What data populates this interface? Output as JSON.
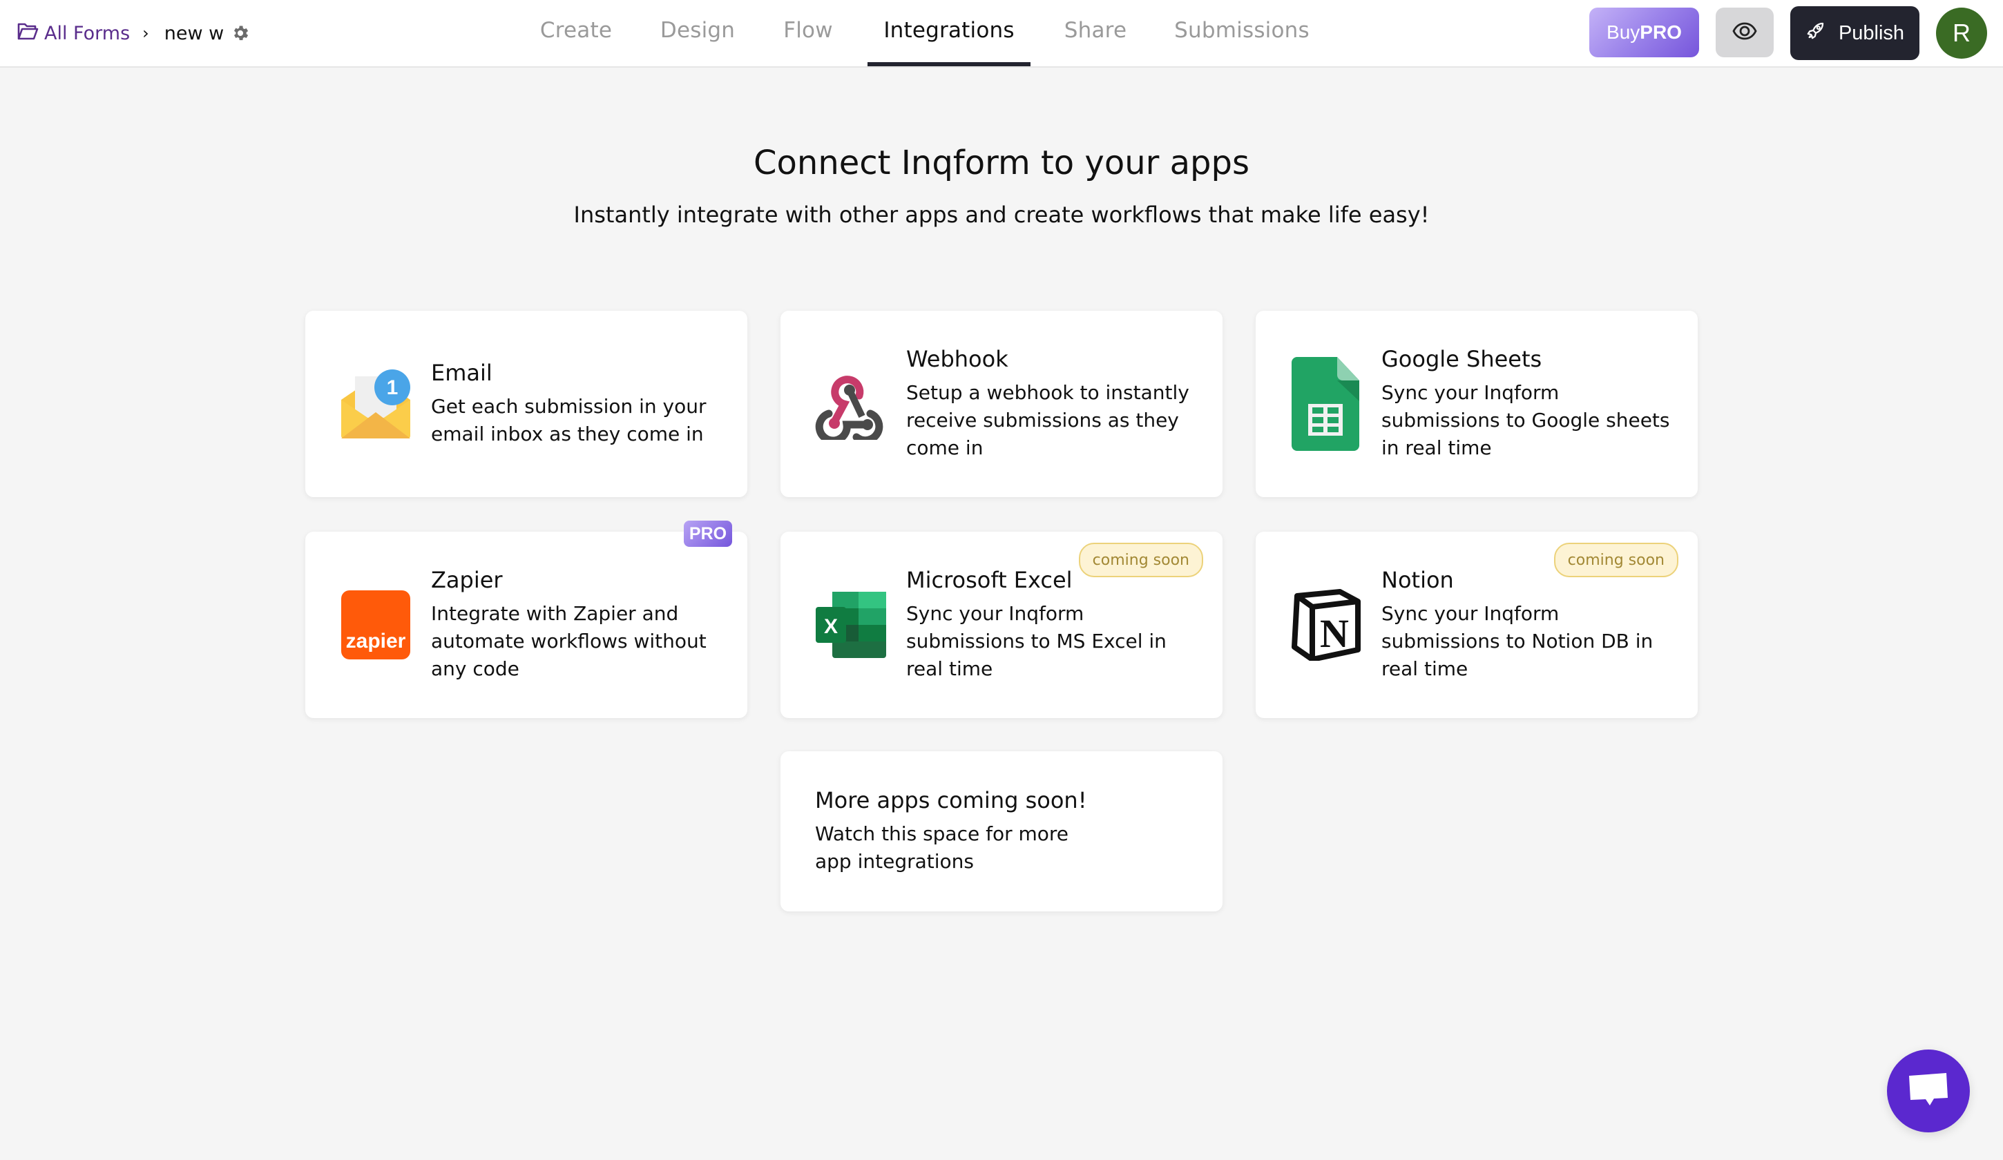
{
  "header": {
    "breadcrumb": {
      "root_label": "All Forms",
      "root_icon": "folder-icon",
      "separator_icon": "chevron-right-icon",
      "current": "new w",
      "settings_icon": "gear-icon"
    },
    "tabs": [
      {
        "label": "Create",
        "active": false
      },
      {
        "label": "Design",
        "active": false
      },
      {
        "label": "Flow",
        "active": false
      },
      {
        "label": "Integrations",
        "active": true
      },
      {
        "label": "Share",
        "active": false
      },
      {
        "label": "Submissions",
        "active": false
      }
    ],
    "buy_pro": {
      "prefix": "Buy",
      "bold": "PRO"
    },
    "preview_icon": "eye-icon",
    "publish": {
      "label": "Publish",
      "icon": "rocket-icon"
    },
    "avatar_initial": "R"
  },
  "hero": {
    "title": "Connect Inqform to your apps",
    "subtitle": "Instantly integrate with other apps and create workflows that make life easy!"
  },
  "integrations": [
    {
      "name": "Email",
      "description": "Get each submission in your email inbox as they come in",
      "icon": "email-icon",
      "badge": null
    },
    {
      "name": "Webhook",
      "description": "Setup a webhook to instantly receive submissions as they come in",
      "icon": "webhook-icon",
      "badge": null
    },
    {
      "name": "Google Sheets",
      "description": "Sync your Inqform submissions to Google sheets in real time",
      "icon": "google-sheets-icon",
      "badge": null
    },
    {
      "name": "Zapier",
      "description": "Integrate with Zapier and automate workflows without any code",
      "icon": "zapier-icon",
      "badge": "PRO",
      "icon_text": "zapier"
    },
    {
      "name": "Microsoft Excel",
      "description": "Sync your Inqform submissions to MS Excel in real time",
      "icon": "excel-icon",
      "badge": "coming soon"
    },
    {
      "name": "Notion",
      "description": "Sync your Inqform submissions to Notion DB in real time",
      "icon": "notion-icon",
      "badge": "coming soon"
    }
  ],
  "more_apps": {
    "title": "More apps coming soon!",
    "description": "Watch this space for more app integrations"
  },
  "email_icon_count": "1",
  "chat_widget": {
    "icon": "chat-bubble-icon"
  },
  "colors": {
    "brand_purple": "#5a2d8c",
    "publish_bg": "#23242f",
    "avatar_bg": "#3a6b24",
    "chat_bg": "#5b28cf",
    "coming_soon_bg": "#fdf3d4"
  }
}
